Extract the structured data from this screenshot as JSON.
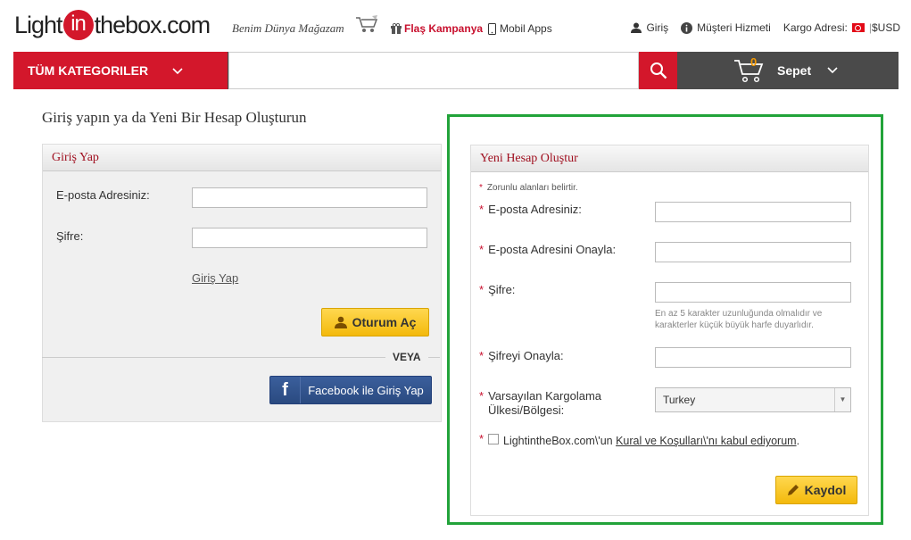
{
  "header": {
    "logo_left": "Light",
    "logo_in": "in",
    "logo_right": "thebox.com",
    "slogan": "Benim Dünya Mağazam",
    "flash": "Flaş Kampanya",
    "mobile": "Mobil Apps",
    "login": "Giriş",
    "support": "Müşteri Hizmeti",
    "shipping": "Kargo Adresi:",
    "currency": "$USD"
  },
  "nav": {
    "categories": "TÜM KATEGORILER",
    "search_placeholder": "",
    "cart_count": "0",
    "cart_label": "Sepet"
  },
  "page_title": "Giriş yapın ya da Yeni Bir Hesap Oluşturun",
  "login": {
    "title": "Giriş Yap",
    "email_label": "E-posta Adresiniz:",
    "password_label": "Şifre:",
    "login_link": "Giriş Yap",
    "login_button": "Oturum Aç",
    "or": "VEYA",
    "facebook": "Facebook ile Giriş Yap"
  },
  "register": {
    "title": "Yeni Hesap Oluştur",
    "required_note": "Zorunlu alanları belirtir.",
    "email_label": "E-posta Adresiniz:",
    "email_confirm_label": "E-posta Adresini Onayla:",
    "password_label": "Şifre:",
    "password_hint": "En az 5 karakter uzunluğunda olmalıdır ve karakterler küçük büyük harfe duyarlıdır.",
    "password_confirm_label": "Şifreyi Onayla:",
    "country_label_1": "Varsayılan Kargolama",
    "country_label_2": "Ülkesi/Bölgesi:",
    "country_value": "Turkey",
    "terms_prefix": "LightintheBox.com\\'un ",
    "terms_link": "Kural ve Koşulları\\'nı kabul ediyorum",
    "terms_suffix": ".",
    "register_button": "Kaydol"
  },
  "colors": {
    "brand": "#d3172b",
    "highlight": "#22a33a"
  }
}
